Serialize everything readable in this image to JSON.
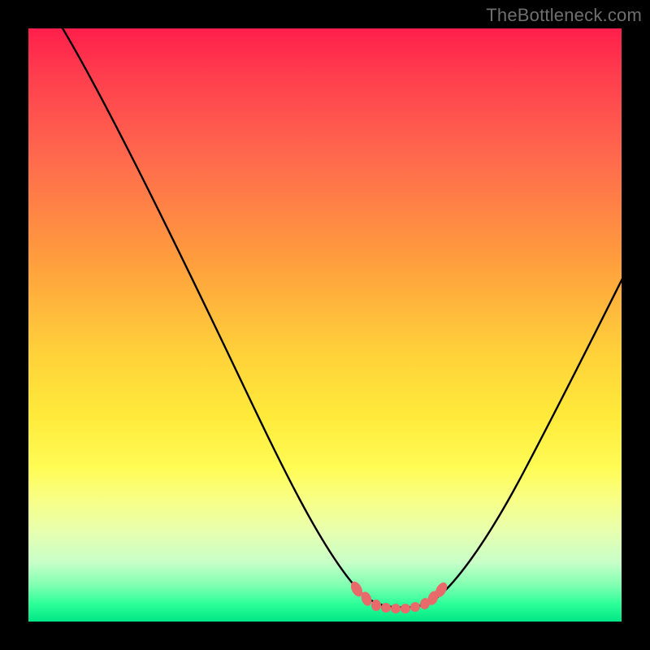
{
  "watermark": "TheBottleneck.com",
  "chart_data": {
    "type": "line",
    "title": "",
    "xlabel": "",
    "ylabel": "",
    "xlim": [
      0,
      100
    ],
    "ylim": [
      0,
      100
    ],
    "series": [
      {
        "name": "bottleneck-curve",
        "x": [
          0,
          5,
          10,
          15,
          20,
          25,
          30,
          35,
          40,
          45,
          50,
          55,
          58,
          60,
          62,
          64,
          66,
          68,
          70,
          75,
          80,
          85,
          90,
          95,
          100
        ],
        "y": [
          105,
          95,
          86,
          77,
          68,
          59,
          50,
          42,
          34,
          26,
          18,
          11,
          7,
          5,
          4,
          3.5,
          3.5,
          4,
          6,
          12,
          20,
          30,
          41,
          52,
          60
        ]
      }
    ],
    "marker_region_x": [
      55,
      70
    ],
    "gradient_colors": {
      "top": "#ff1f4b",
      "mid": "#ffd23a",
      "bottom": "#00e684"
    },
    "marker_color": "#e86a6a",
    "curve_color": "#000000"
  }
}
